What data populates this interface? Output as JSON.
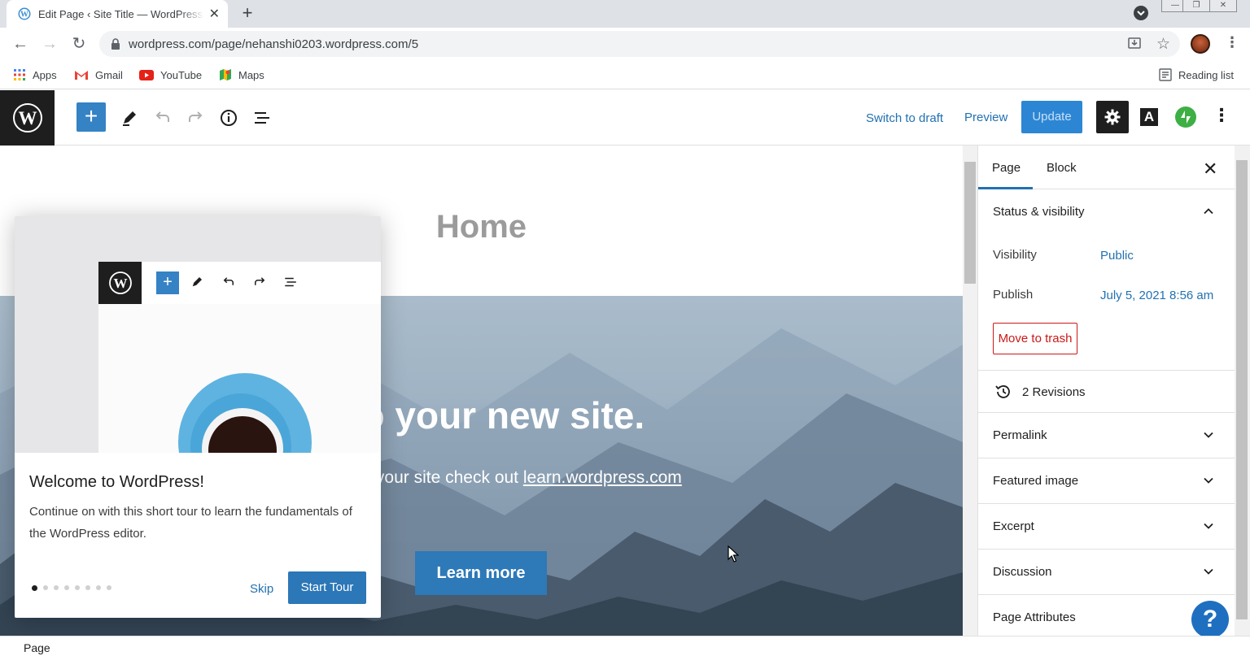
{
  "browser": {
    "tab_title": "Edit Page ‹ Site Title — WordPress",
    "url": "wordpress.com/page/nehanshi0203.wordpress.com/5",
    "bookmarks": [
      {
        "label": "Apps",
        "icon": "apps-grid-icon"
      },
      {
        "label": "Gmail",
        "icon": "gmail-icon"
      },
      {
        "label": "YouTube",
        "icon": "youtube-icon"
      },
      {
        "label": "Maps",
        "icon": "maps-icon"
      }
    ],
    "reading_list": "Reading list"
  },
  "editor_header": {
    "switch_to_draft": "Switch to draft",
    "preview": "Preview",
    "update": "Update",
    "a_button": "A"
  },
  "canvas": {
    "page_title": "Home",
    "cover_heading_visible": "e to your new site.",
    "cover_sub_prefix": "customizing your site check out ",
    "cover_sub_link": "learn.wordpress.com",
    "learn_more": "Learn more"
  },
  "welcome_guide": {
    "title": "Welcome to WordPress!",
    "text": "Continue on with this short tour to learn the fundamentals of the WordPress editor.",
    "skip": "Skip",
    "start_tour": "Start Tour",
    "page_count": 8,
    "current_page": 1
  },
  "sidebar": {
    "tabs": [
      "Page",
      "Block"
    ],
    "active_tab": "Page",
    "status_visibility": {
      "heading": "Status & visibility",
      "visibility_label": "Visibility",
      "visibility_value": "Public",
      "publish_label": "Publish",
      "publish_value": "July 5, 2021 8:56 am",
      "move_to_trash": "Move to trash"
    },
    "revisions": "2 Revisions",
    "panels": [
      "Permalink",
      "Featured image",
      "Excerpt",
      "Discussion",
      "Page Attributes"
    ],
    "help": "?"
  },
  "footer": {
    "breadcrumb": "Page"
  },
  "colors": {
    "wp_blue": "#2271b1",
    "update_button": "#2c86d4",
    "trash_red": "#cc1818",
    "dark": "#1e1e1e"
  }
}
